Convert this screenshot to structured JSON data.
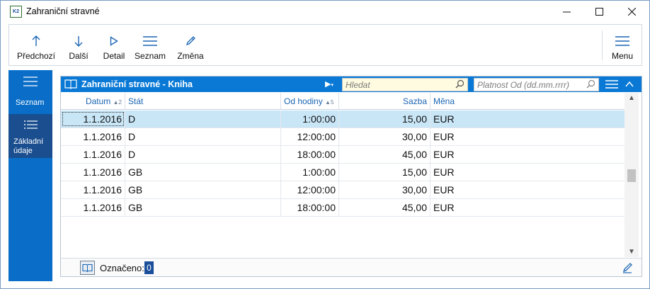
{
  "window": {
    "title": "Zahraniční stravné",
    "app_icon_text": "K2"
  },
  "toolbar": {
    "buttons": [
      {
        "label": "Předchozí",
        "icon": "arrow-up-icon"
      },
      {
        "label": "Další",
        "icon": "arrow-down-icon"
      },
      {
        "label": "Detail",
        "icon": "play-icon"
      },
      {
        "label": "Seznam",
        "icon": "list-icon"
      },
      {
        "label": "Změna",
        "icon": "pencil-icon"
      }
    ],
    "menu_label": "Menu"
  },
  "sidebar": {
    "items": [
      {
        "label": "Seznam",
        "icon": "list-icon",
        "active": true
      },
      {
        "label": "Základní údaje",
        "line1": "Základní",
        "line2": "údaje",
        "icon": "details-list-icon",
        "active": false
      }
    ]
  },
  "panel": {
    "title": "Zahraniční stravné - Kniha",
    "search_placeholder": "Hledat",
    "date_placeholder": "Platnost Od (dd.mm.rrrr)"
  },
  "table": {
    "columns": [
      {
        "label": "Datum",
        "sort": "▲",
        "sort_index": "2"
      },
      {
        "label": "Stát"
      },
      {
        "label": "Od hodiny",
        "sort": "▲",
        "sort_index": "5"
      },
      {
        "label": "Sazba"
      },
      {
        "label": "Měna"
      }
    ],
    "rows": [
      {
        "datum": "1.1.2016",
        "stat": "D",
        "od": "1:00:00",
        "sazba": "15,00",
        "mena": "EUR",
        "selected": true
      },
      {
        "datum": "1.1.2016",
        "stat": "D",
        "od": "12:00:00",
        "sazba": "30,00",
        "mena": "EUR"
      },
      {
        "datum": "1.1.2016",
        "stat": "D",
        "od": "18:00:00",
        "sazba": "45,00",
        "mena": "EUR"
      },
      {
        "datum": "1.1.2016",
        "stat": "GB",
        "od": "1:00:00",
        "sazba": "15,00",
        "mena": "EUR"
      },
      {
        "datum": "1.1.2016",
        "stat": "GB",
        "od": "12:00:00",
        "sazba": "30,00",
        "mena": "EUR"
      },
      {
        "datum": "1.1.2016",
        "stat": "GB",
        "od": "18:00:00",
        "sazba": "45,00",
        "mena": "EUR"
      }
    ]
  },
  "status": {
    "marked_label": "Označeno:",
    "marked_count": "0"
  },
  "colors": {
    "accent": "#0a79d6",
    "sidebar": "#0a6ec8",
    "selected_row": "#c9e6f7"
  }
}
